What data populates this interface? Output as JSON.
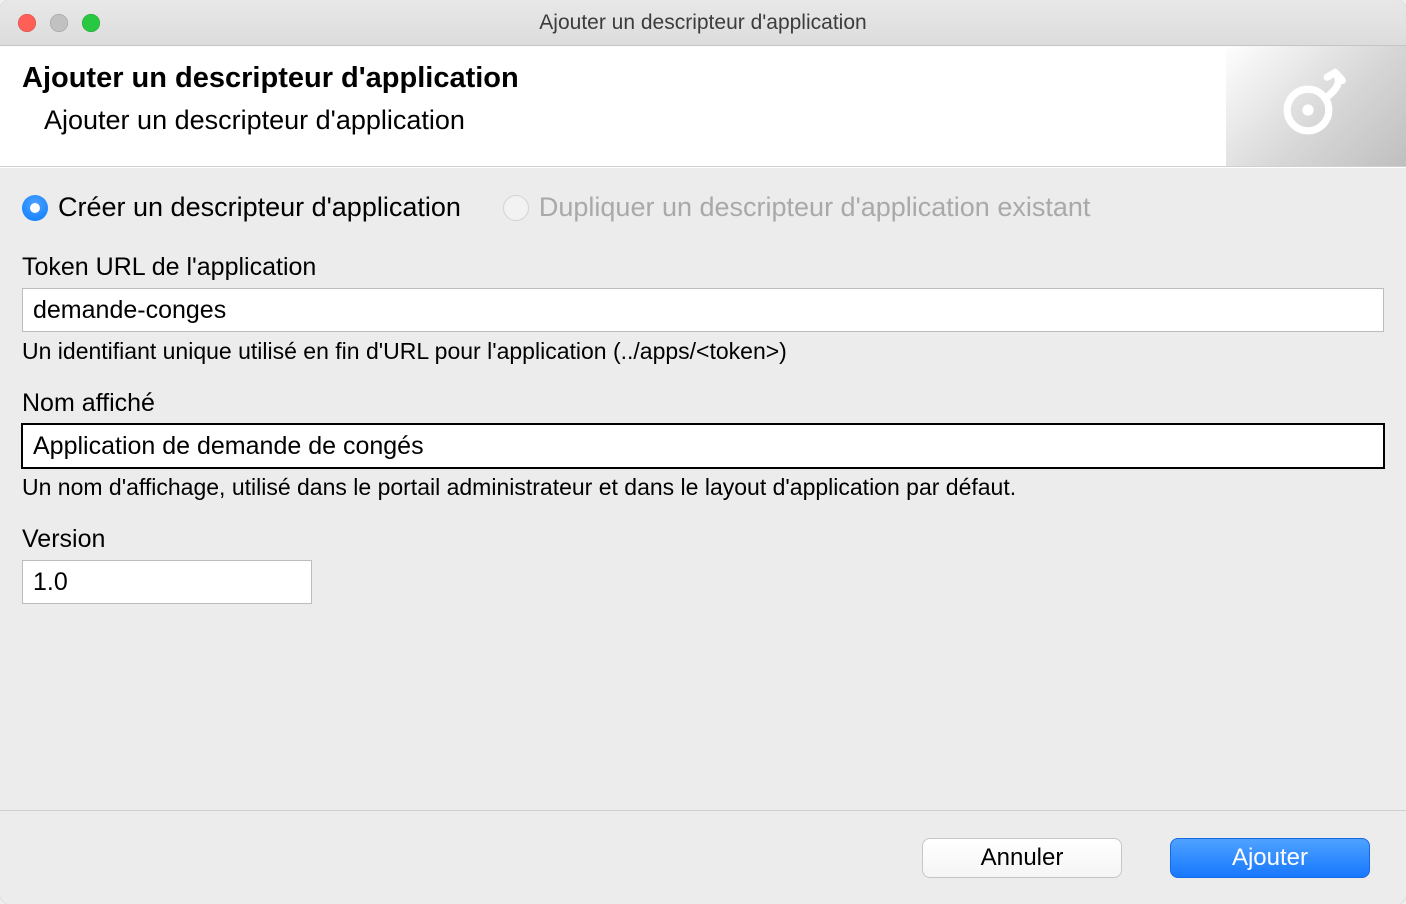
{
  "window": {
    "title": "Ajouter un descripteur d'application"
  },
  "header": {
    "title": "Ajouter un descripteur d'application",
    "subtitle": "Ajouter un descripteur d'application"
  },
  "radios": {
    "create": "Créer un descripteur d'application",
    "duplicate": "Dupliquer un descripteur d'application existant"
  },
  "fields": {
    "token": {
      "label": "Token URL de l'application",
      "value": "demande-conges",
      "hint": "Un identifiant unique utilisé en fin d'URL pour l'application (../apps/<token>)"
    },
    "displayName": {
      "label": "Nom affiché",
      "value": "Application de demande de congés",
      "hint": "Un nom d'affichage, utilisé dans le portail administrateur et dans le layout d'application par défaut."
    },
    "version": {
      "label": "Version",
      "value": "1.0"
    }
  },
  "buttons": {
    "cancel": "Annuler",
    "add": "Ajouter"
  }
}
